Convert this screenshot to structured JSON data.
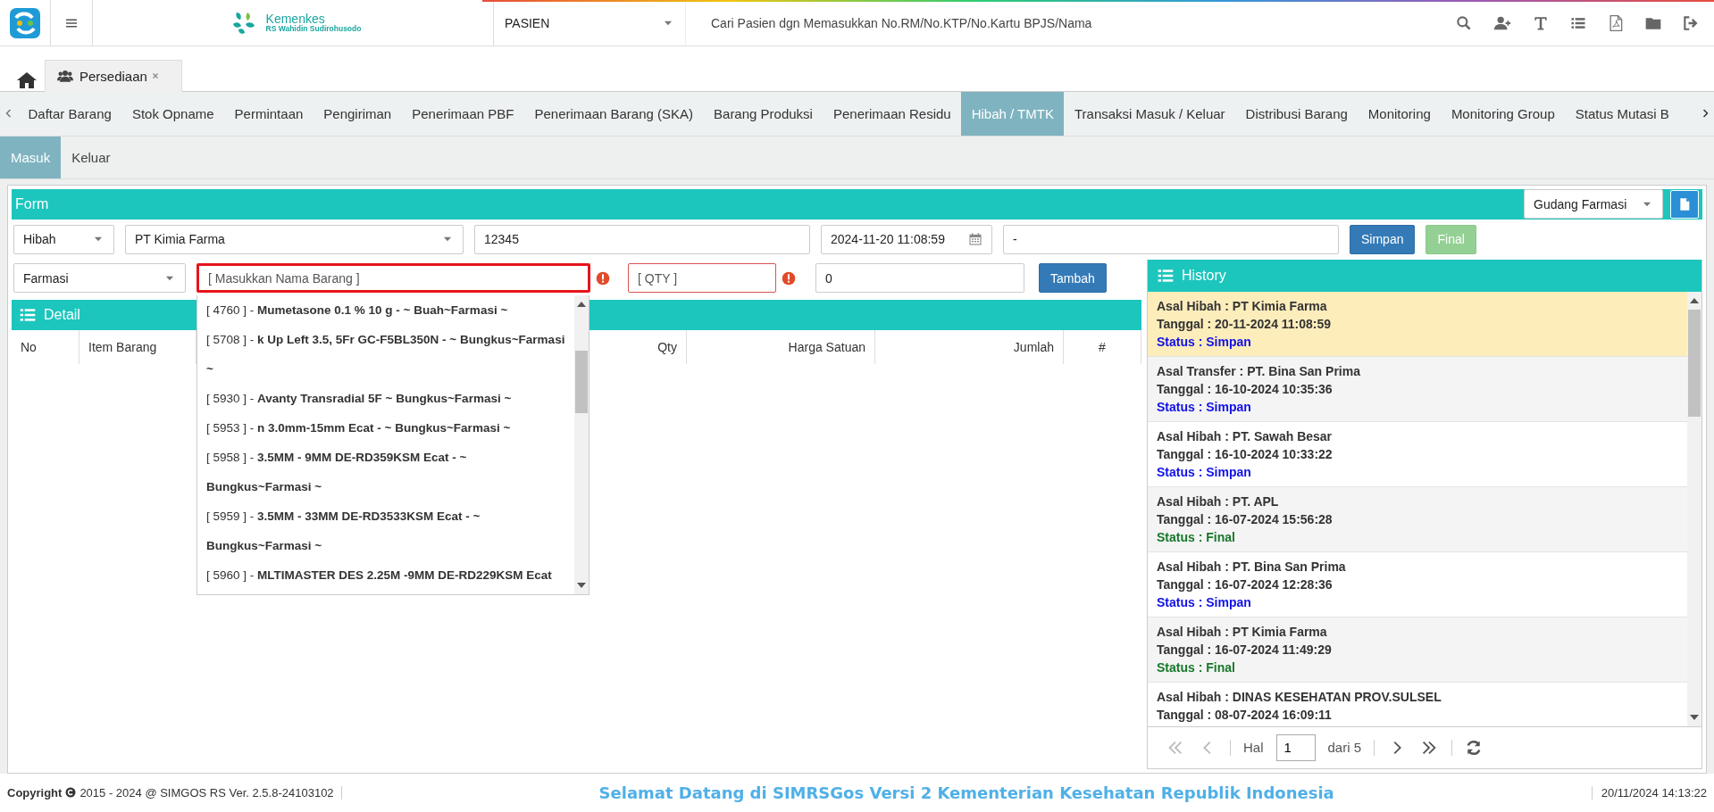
{
  "header": {
    "logo_title": "Kemenkes",
    "logo_subtitle": "RS Wahidin Sudirohusodo",
    "module_select": "PASIEN",
    "search_placeholder": "Cari Pasien dgn Memasukkan No.RM/No.KTP/No.Kartu BPJS/Nama"
  },
  "open_tabs": [
    {
      "label": "Persediaan",
      "selected": true
    }
  ],
  "nav_tabs": [
    {
      "label": "Daftar Barang",
      "selected": false
    },
    {
      "label": "Stok Opname",
      "selected": false
    },
    {
      "label": "Permintaan",
      "selected": false
    },
    {
      "label": "Pengiriman",
      "selected": false
    },
    {
      "label": "Penerimaan PBF",
      "selected": false
    },
    {
      "label": "Penerimaan Barang (SKA)",
      "selected": false
    },
    {
      "label": "Barang Produksi",
      "selected": false
    },
    {
      "label": "Penerimaan Residu",
      "selected": false
    },
    {
      "label": "Hibah / TMTK",
      "selected": true
    },
    {
      "label": "Transaksi Masuk / Keluar",
      "selected": false
    },
    {
      "label": "Distribusi Barang",
      "selected": false
    },
    {
      "label": "Monitoring",
      "selected": false
    },
    {
      "label": "Monitoring Group",
      "selected": false
    },
    {
      "label": "Status Mutasi B",
      "selected": false
    }
  ],
  "sub_tabs": [
    {
      "label": "Masuk",
      "selected": true
    },
    {
      "label": "Keluar",
      "selected": false
    }
  ],
  "form": {
    "title": "Form",
    "warehouse": "Gudang Farmasi",
    "type": "Hibah",
    "source": "PT Kimia Farma",
    "number": "12345",
    "date": "2024-11-20 11:08:59",
    "note": "-",
    "buttons": [
      {
        "label": "Simpan",
        "kind": "primary",
        "disabled": false
      },
      {
        "label": "Final",
        "kind": "success",
        "disabled": true
      }
    ]
  },
  "item_entry": {
    "category": "Farmasi",
    "name_placeholder": "[ Masukkan Nama Barang ]",
    "name_invalid": true,
    "qty_placeholder": "[ QTY ]",
    "qty_invalid": true,
    "price": "0",
    "add_button": "Tambah"
  },
  "suggestions": [
    {
      "text": "[ 4760 ] - **Mumetasone 0.1 % 10 g - ~ Buah~Farmasi ~**"
    },
    {
      "text": "[ 5708 ] - **k Up Left 3.5, 5Fr GC-F5BL350N - ~ Bungkus~Farmasi ~**"
    },
    {
      "text": "[ 5930 ] - **Avanty Transradial 5F ~ Bungkus~Farmasi ~**"
    },
    {
      "text": "[ 5953 ] - **n 3.0mm-15mm Ecat - ~ Bungkus~Farmasi ~**"
    },
    {
      "text": "[ 5958 ] - **3.5MM - 9MM DE-RD359KSM Ecat - ~ Bungkus~Farmasi ~**"
    },
    {
      "text": "[ 5959 ] - **3.5MM - 33MM DE-RD3533KSM Ecat - ~ Bungkus~Farmasi ~**"
    },
    {
      "text": "[ 5960 ] - **MLTIMASTER DES 2.25M -9MM DE-RD229KSM Ecat**"
    }
  ],
  "detail": {
    "title": "Detail",
    "columns": [
      "No",
      "Item Barang",
      "Qty",
      "Harga Satuan",
      "Jumlah",
      "#"
    ]
  },
  "history": {
    "title": "History",
    "items": [
      {
        "origin": "Asal Hibah : PT Kimia Farma",
        "date": "Tanggal : 20-11-2024 11:08:59",
        "status": "Status : Simpan",
        "color": "#1010e8",
        "selected": true
      },
      {
        "origin": "Asal Transfer : PT. Bina San Prima",
        "date": "Tanggal : 16-10-2024 10:35:36",
        "status": "Status : Simpan",
        "color": "#1010e8",
        "selected": false
      },
      {
        "origin": "Asal Hibah : PT. Sawah Besar",
        "date": "Tanggal : 16-10-2024 10:33:22",
        "status": "Status : Simpan",
        "color": "#1010e8",
        "selected": false
      },
      {
        "origin": "Asal Hibah : PT. APL",
        "date": "Tanggal : 16-07-2024 15:56:28",
        "status": "Status : Final",
        "color": "#17782a",
        "selected": false
      },
      {
        "origin": "Asal Hibah : PT. Bina San Prima",
        "date": "Tanggal : 16-07-2024 12:28:36",
        "status": "Status : Simpan",
        "color": "#1010e8",
        "selected": false
      },
      {
        "origin": "Asal Hibah : PT Kimia Farma",
        "date": "Tanggal : 16-07-2024 11:49:29",
        "status": "Status : Final",
        "color": "#17782a",
        "selected": false
      },
      {
        "origin": "Asal Hibah : DINAS KESEHATAN PROV.SULSEL",
        "date": "Tanggal : 08-07-2024 16:09:11",
        "selected": false
      }
    ],
    "pagination": {
      "page_label": "Hal",
      "page": "1",
      "total": "dari 5"
    }
  },
  "footer": {
    "copyright_label": "Copyright",
    "copyright_text": "2015 - 2024 @ SIMGOS RS Ver. 2.5.8-24103102",
    "welcome": "Selamat Datang di SIMRSGos Versi 2 Kementerian Kesehatan Republik Indonesia",
    "datetime": "20/11/2024 14:13:22"
  }
}
